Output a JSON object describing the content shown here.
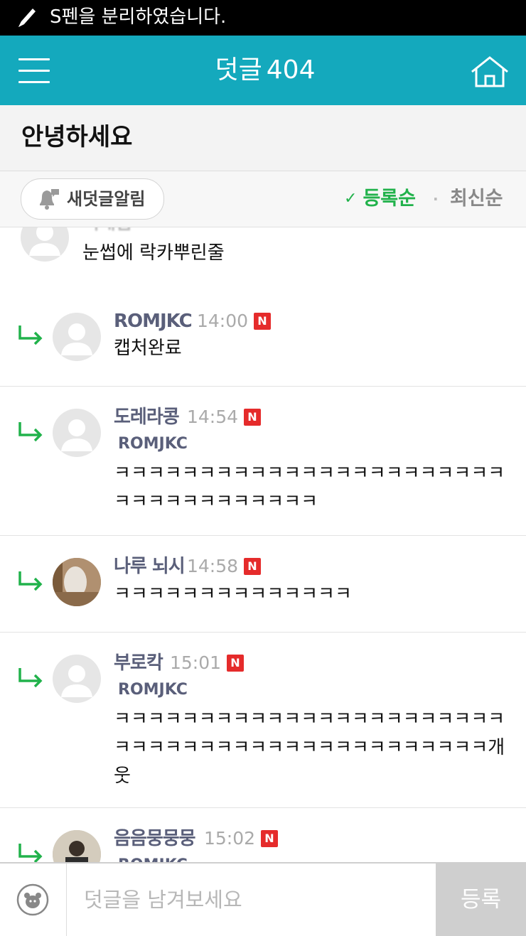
{
  "status_bar": {
    "message": "S펜을 분리하였습니다."
  },
  "app_bar": {
    "title": "덧글",
    "count": "404"
  },
  "post": {
    "title": "안녕하세요"
  },
  "toolbar": {
    "alarm_label": "새덧글알림",
    "sort_registered": "등록순",
    "sort_latest": "최신순",
    "separator": "·",
    "check": "✓"
  },
  "comments": [
    {
      "nick": "",
      "time": "",
      "mention": "",
      "text": "눈썹에 락카뿌린줄",
      "badge": ""
    },
    {
      "nick": "ROMJKC",
      "time": "14:00",
      "mention": "",
      "text": "캡처완료",
      "badge": "N"
    },
    {
      "nick": "도레라콩",
      "time": "14:54",
      "mention": "ROMJKC",
      "text": "ㅋㅋㅋㅋㅋㅋㅋㅋㅋㅋㅋㅋㅋㅋㅋㅋㅋㅋㅋㅋㅋㅋㅋㅋㅋㅋㅋㅋㅋㅋㅋㅋㅋㅋㅋ",
      "badge": "N"
    },
    {
      "nick": "나루 뇌시",
      "time": "14:58",
      "mention": "",
      "text": "ㅋㅋㅋㅋㅋㅋㅋㅋㅋㅋㅋㅋㅋㅋ",
      "badge": "N"
    },
    {
      "nick": "부로칵",
      "time": "15:01",
      "mention": "ROMJKC",
      "text": "ㅋㅋㅋㅋㅋㅋㅋㅋㅋㅋㅋㅋㅋㅋㅋㅋㅋㅋㅋㅋㅋㅋㅋㅋㅋㅋㅋㅋㅋㅋㅋㅋㅋㅋㅋㅋㅋㅋㅋㅋㅋㅋㅋㅋㅋ개웃",
      "badge": "N"
    },
    {
      "nick": "음음뭉뭉뭉",
      "time": "15:02",
      "mention": "ROMJKC",
      "text": "",
      "badge": "N"
    }
  ],
  "composer": {
    "placeholder": "덧글을 남겨보세요",
    "submit": "등록"
  },
  "colors": {
    "accent": "#14a9bd",
    "green": "#21b24b",
    "badge": "#e52b2b"
  },
  "icons": {
    "pen": "pen-icon",
    "menu": "menu-icon",
    "home": "home-icon",
    "bell": "bell-icon",
    "reply": "reply-arrow-icon",
    "emoji": "emoji-icon"
  }
}
